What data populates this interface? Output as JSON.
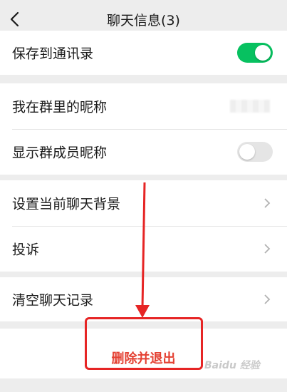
{
  "header": {
    "title": "聊天信息(3)"
  },
  "groups": {
    "first": {
      "save_to_contacts": {
        "label": "保存到通讯录",
        "enabled": true
      }
    },
    "second": {
      "my_nickname": {
        "label": "我在群里的昵称"
      },
      "show_member_nicknames": {
        "label": "显示群成员昵称",
        "enabled": false
      }
    },
    "third": {
      "chat_background": {
        "label": "设置当前聊天背景"
      },
      "complain": {
        "label": "投诉"
      }
    },
    "fourth": {
      "clear_history": {
        "label": "清空聊天记录"
      }
    },
    "fifth": {
      "delete_and_exit": {
        "label": "删除并退出"
      }
    }
  },
  "colors": {
    "toggle_on": "#07c160",
    "danger": "#e44133",
    "annotation": "#e62525"
  },
  "watermark": "Baidu 经验"
}
